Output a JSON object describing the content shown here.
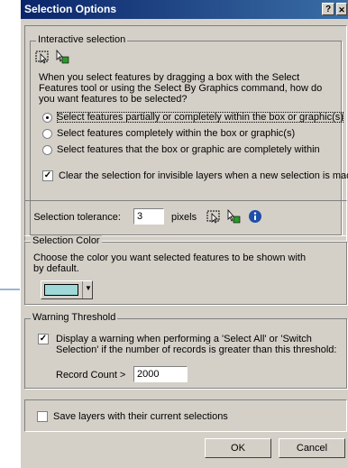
{
  "window": {
    "title": "Selection Options",
    "help_button": "?",
    "close_button": "X"
  },
  "interactive": {
    "legend": "Interactive selection",
    "description": [
      "When you select features by dragging a box with the Select",
      "Features tool or using the Select By Graphics command, how do",
      "you want features to be selected?"
    ],
    "options": [
      "Select features partially or completely within the box or graphic(s)",
      "Select features completely within the box or graphic(s)",
      "Select features that the box or graphic are completely within"
    ],
    "selected_index": 0,
    "clear_label": "Clear the selection for invisible layers when a new selection is made",
    "clear_checked": true
  },
  "tolerance": {
    "label": "Selection tolerance:",
    "value": "3",
    "unit": "pixels"
  },
  "color": {
    "legend": "Selection Color",
    "description": [
      "Choose the color you want selected features to be shown with",
      "by default."
    ],
    "swatch_color": "#9ed8d8"
  },
  "warning": {
    "legend": "Warning Threshold",
    "display_label": [
      "Display a warning when performing a 'Select All' or 'Switch",
      "Selection' if the number of records is greater than this threshold:"
    ],
    "display_checked": true,
    "record_label": "Record Count >",
    "record_value": "2000"
  },
  "save": {
    "label": "Save layers with their current selections",
    "checked": false
  },
  "buttons": {
    "ok": "OK",
    "cancel": "Cancel"
  },
  "icons": [
    "select-box-icon",
    "select-graphics-icon",
    "info-icon"
  ],
  "callout_line_color": "#3a6ea5"
}
